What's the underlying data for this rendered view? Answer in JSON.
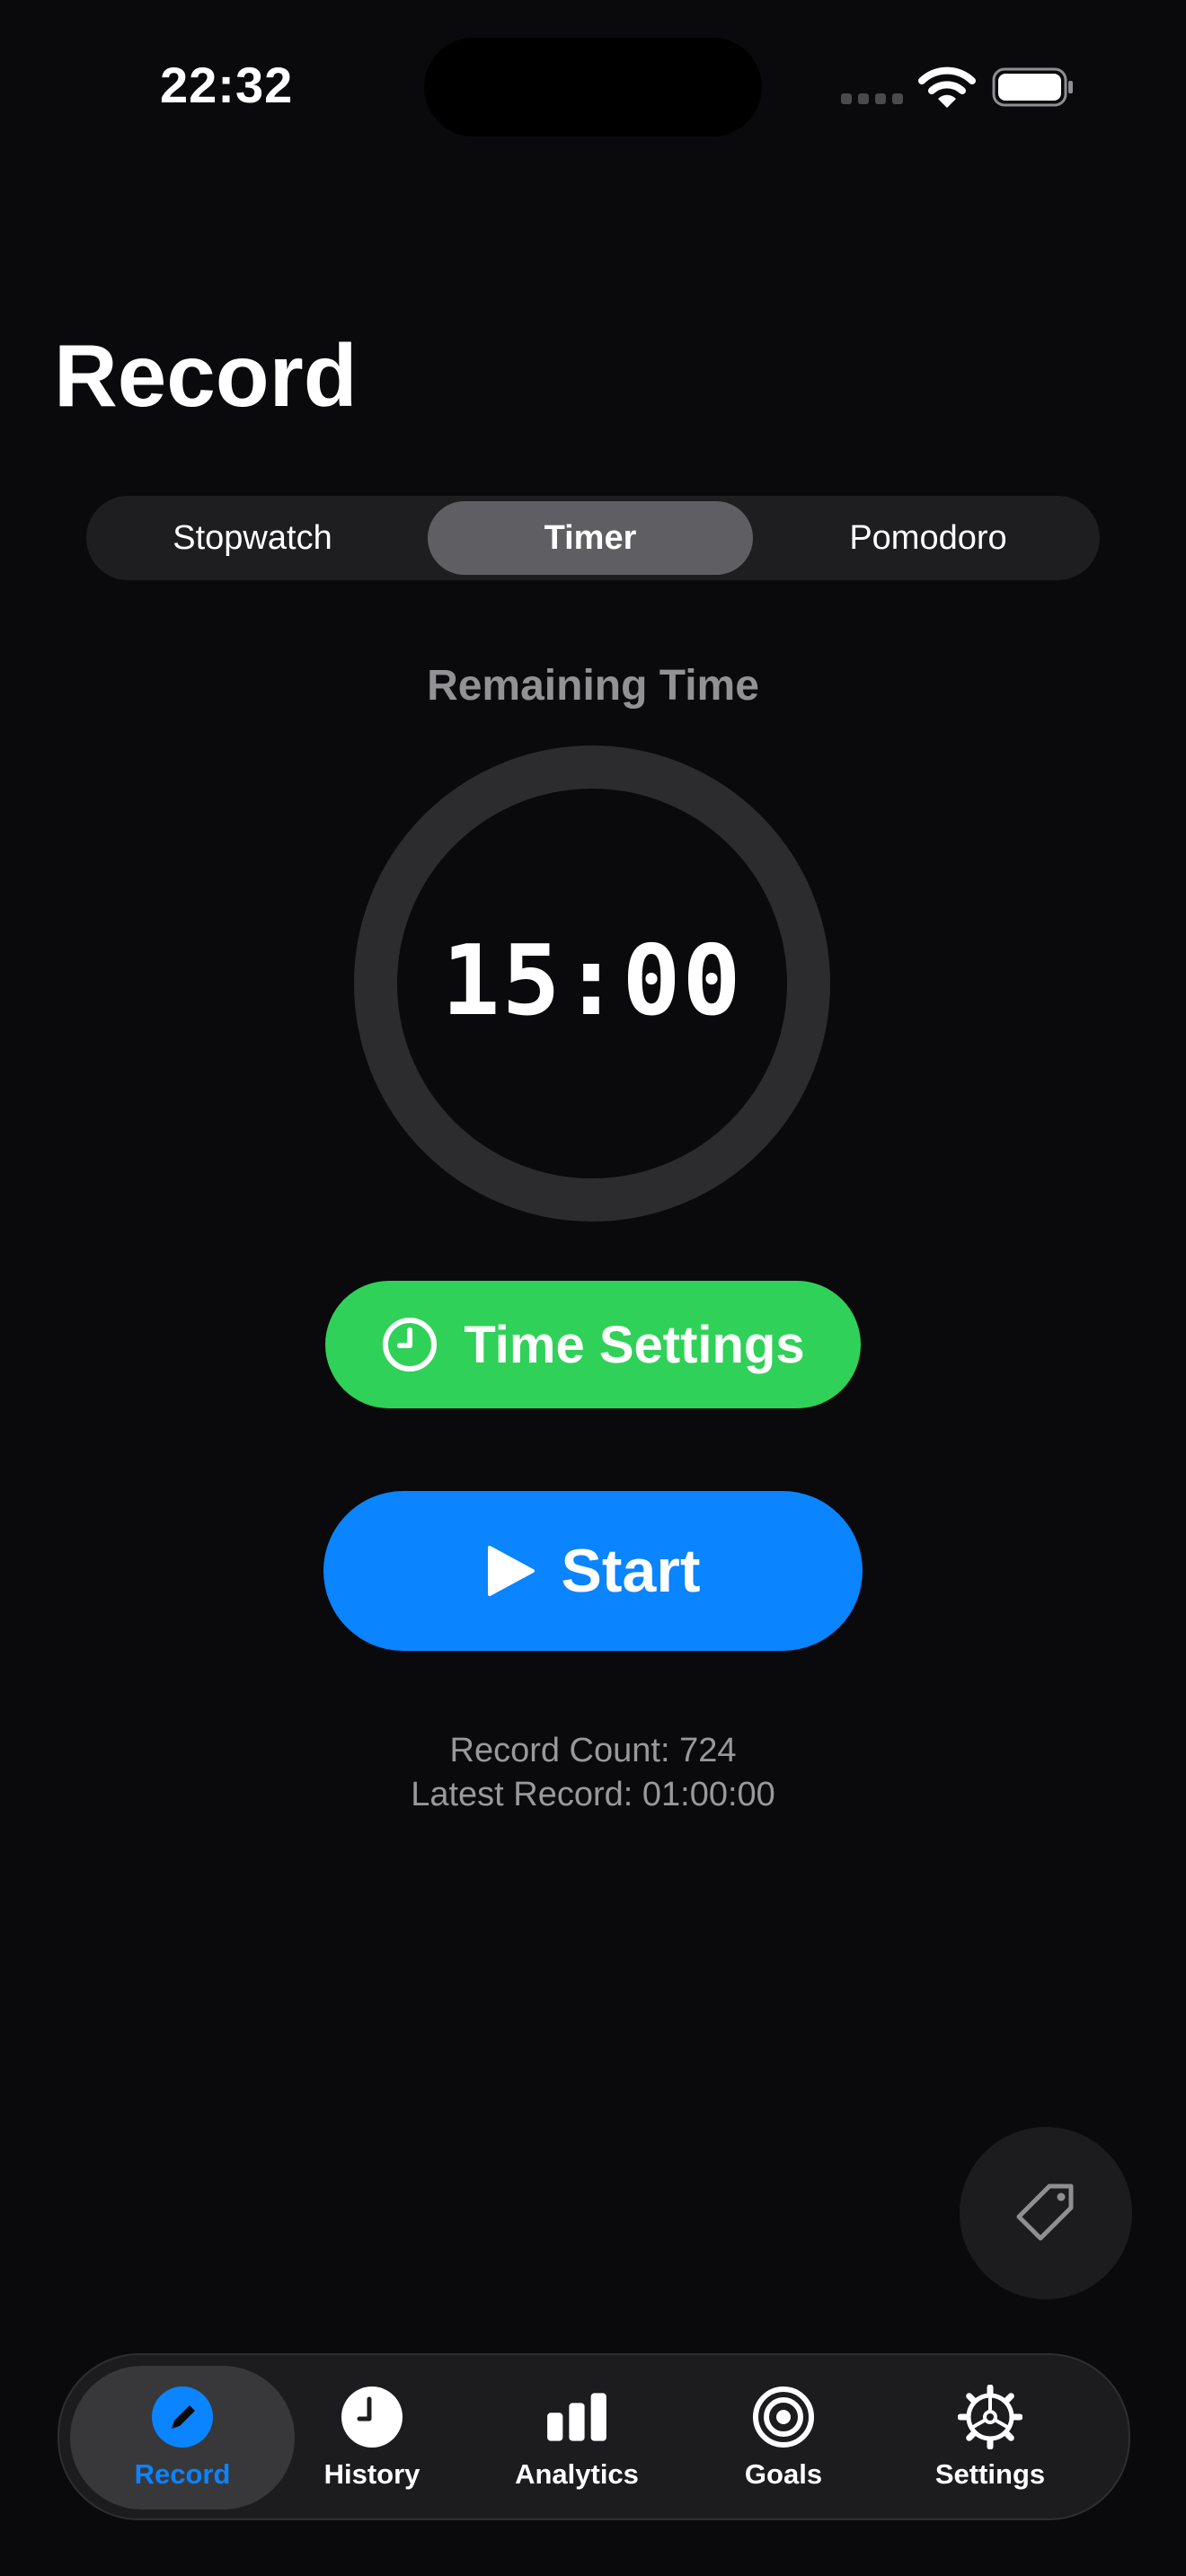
{
  "status_bar": {
    "time": "22:32"
  },
  "page": {
    "title": "Record"
  },
  "segments": [
    {
      "label": "Stopwatch",
      "selected": false
    },
    {
      "label": "Timer",
      "selected": true
    },
    {
      "label": "Pomodoro",
      "selected": false
    }
  ],
  "timer": {
    "label": "Remaining Time",
    "value": "15:00"
  },
  "buttons": {
    "time_settings_label": "Time Settings",
    "start_label": "Start"
  },
  "record_info": {
    "count": "Record Count: 724",
    "latest": "Latest Record: 01:00:00"
  },
  "tab_bar": [
    {
      "label": "Record",
      "icon": "pencil-icon",
      "selected": true
    },
    {
      "label": "History",
      "icon": "clock-icon",
      "selected": false
    },
    {
      "label": "Analytics",
      "icon": "bar-chart-icon",
      "selected": false
    },
    {
      "label": "Goals",
      "icon": "target-icon",
      "selected": false
    },
    {
      "label": "Settings",
      "icon": "gear-icon",
      "selected": false
    }
  ],
  "colors": {
    "accent_blue": "#0a84ff",
    "accent_green": "#30d158",
    "background": "#0a0a0c"
  }
}
